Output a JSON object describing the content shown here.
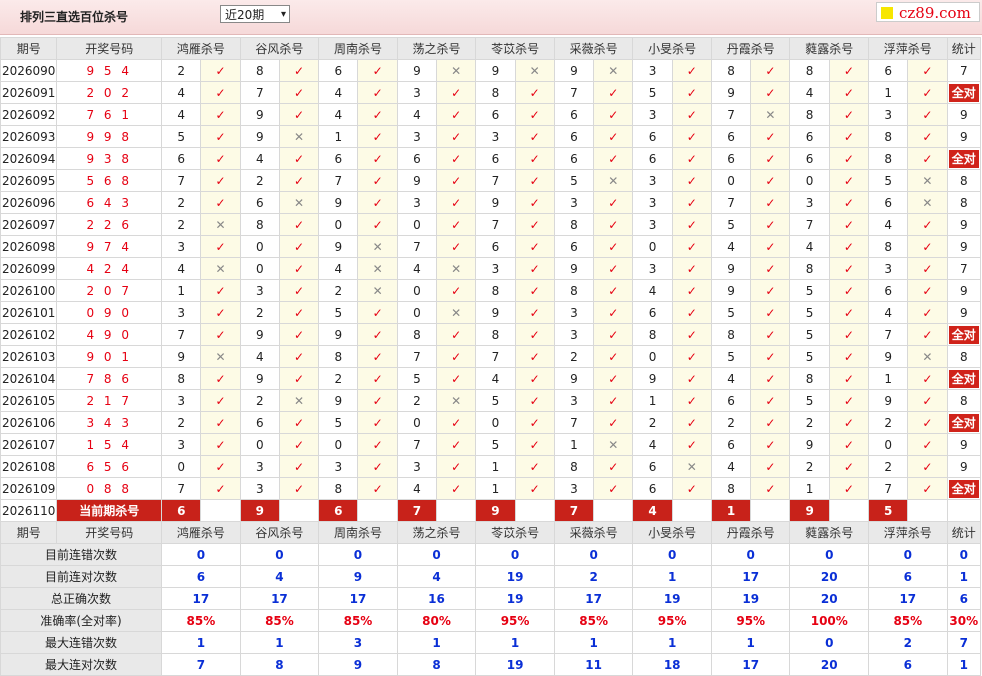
{
  "header": {
    "title": "排列三直选百位杀号",
    "select_value": "近20期",
    "logo_text": "cz89.com"
  },
  "columns": {
    "period": "期号",
    "number": "开奖号码",
    "experts": [
      "鸿雁杀号",
      "谷风杀号",
      "周南杀号",
      "荡之杀号",
      "苓苡杀号",
      "采薇杀号",
      "小旻杀号",
      "丹霞杀号",
      "蕤露杀号",
      "浮萍杀号"
    ],
    "stat": "统计"
  },
  "rows": [
    {
      "period": "2026090",
      "number": "954",
      "kills": [
        2,
        8,
        6,
        9,
        9,
        9,
        3,
        8,
        8,
        6
      ],
      "hits": [
        1,
        1,
        1,
        0,
        0,
        0,
        1,
        1,
        1,
        1
      ],
      "stat": "7"
    },
    {
      "period": "2026091",
      "number": "202",
      "kills": [
        4,
        7,
        4,
        3,
        8,
        7,
        5,
        9,
        4,
        1
      ],
      "hits": [
        1,
        1,
        1,
        1,
        1,
        1,
        1,
        1,
        1,
        1
      ],
      "stat": "全对"
    },
    {
      "period": "2026092",
      "number": "761",
      "kills": [
        4,
        9,
        4,
        4,
        6,
        6,
        3,
        7,
        8,
        3
      ],
      "hits": [
        1,
        1,
        1,
        1,
        1,
        1,
        1,
        0,
        1,
        1
      ],
      "stat": "9"
    },
    {
      "period": "2026093",
      "number": "998",
      "kills": [
        5,
        9,
        1,
        3,
        3,
        6,
        6,
        6,
        6,
        8
      ],
      "hits": [
        1,
        0,
        1,
        1,
        1,
        1,
        1,
        1,
        1,
        1
      ],
      "stat": "9"
    },
    {
      "period": "2026094",
      "number": "938",
      "kills": [
        6,
        4,
        6,
        6,
        6,
        6,
        6,
        6,
        6,
        8
      ],
      "hits": [
        1,
        1,
        1,
        1,
        1,
        1,
        1,
        1,
        1,
        1
      ],
      "stat": "全对"
    },
    {
      "period": "2026095",
      "number": "568",
      "kills": [
        7,
        2,
        7,
        9,
        7,
        5,
        3,
        0,
        0,
        5
      ],
      "hits": [
        1,
        1,
        1,
        1,
        1,
        0,
        1,
        1,
        1,
        0
      ],
      "stat": "8"
    },
    {
      "period": "2026096",
      "number": "643",
      "kills": [
        2,
        6,
        9,
        3,
        9,
        3,
        3,
        7,
        3,
        6
      ],
      "hits": [
        1,
        0,
        1,
        1,
        1,
        1,
        1,
        1,
        1,
        0
      ],
      "stat": "8"
    },
    {
      "period": "2026097",
      "number": "226",
      "kills": [
        2,
        8,
        0,
        0,
        7,
        8,
        3,
        5,
        7,
        4
      ],
      "hits": [
        0,
        1,
        1,
        1,
        1,
        1,
        1,
        1,
        1,
        1
      ],
      "stat": "9"
    },
    {
      "period": "2026098",
      "number": "974",
      "kills": [
        3,
        0,
        9,
        7,
        6,
        6,
        0,
        4,
        4,
        8
      ],
      "hits": [
        1,
        1,
        0,
        1,
        1,
        1,
        1,
        1,
        1,
        1
      ],
      "stat": "9"
    },
    {
      "period": "2026099",
      "number": "424",
      "kills": [
        4,
        0,
        4,
        4,
        3,
        9,
        3,
        9,
        8,
        3
      ],
      "hits": [
        0,
        1,
        0,
        0,
        1,
        1,
        1,
        1,
        1,
        1
      ],
      "stat": "7"
    },
    {
      "period": "2026100",
      "number": "207",
      "kills": [
        1,
        3,
        2,
        0,
        8,
        8,
        4,
        9,
        5,
        6
      ],
      "hits": [
        1,
        1,
        0,
        1,
        1,
        1,
        1,
        1,
        1,
        1
      ],
      "stat": "9"
    },
    {
      "period": "2026101",
      "number": "090",
      "kills": [
        3,
        2,
        5,
        0,
        9,
        3,
        6,
        5,
        5,
        4
      ],
      "hits": [
        1,
        1,
        1,
        0,
        1,
        1,
        1,
        1,
        1,
        1
      ],
      "stat": "9"
    },
    {
      "period": "2026102",
      "number": "490",
      "kills": [
        7,
        9,
        9,
        8,
        8,
        3,
        8,
        8,
        5,
        7
      ],
      "hits": [
        1,
        1,
        1,
        1,
        1,
        1,
        1,
        1,
        1,
        1
      ],
      "stat": "全对"
    },
    {
      "period": "2026103",
      "number": "901",
      "kills": [
        9,
        4,
        8,
        7,
        7,
        2,
        0,
        5,
        5,
        9
      ],
      "hits": [
        0,
        1,
        1,
        1,
        1,
        1,
        1,
        1,
        1,
        0
      ],
      "stat": "8"
    },
    {
      "period": "2026104",
      "number": "786",
      "kills": [
        8,
        9,
        2,
        5,
        4,
        9,
        9,
        4,
        8,
        1
      ],
      "hits": [
        1,
        1,
        1,
        1,
        1,
        1,
        1,
        1,
        1,
        1
      ],
      "stat": "全对"
    },
    {
      "period": "2026105",
      "number": "217",
      "kills": [
        3,
        2,
        9,
        2,
        5,
        3,
        1,
        6,
        5,
        9
      ],
      "hits": [
        1,
        0,
        1,
        0,
        1,
        1,
        1,
        1,
        1,
        1
      ],
      "stat": "8"
    },
    {
      "period": "2026106",
      "number": "343",
      "kills": [
        2,
        6,
        5,
        0,
        0,
        7,
        2,
        2,
        2,
        2
      ],
      "hits": [
        1,
        1,
        1,
        1,
        1,
        1,
        1,
        1,
        1,
        1
      ],
      "stat": "全对"
    },
    {
      "period": "2026107",
      "number": "154",
      "kills": [
        3,
        0,
        0,
        7,
        5,
        1,
        4,
        6,
        9,
        0
      ],
      "hits": [
        1,
        1,
        1,
        1,
        1,
        0,
        1,
        1,
        1,
        1
      ],
      "stat": "9"
    },
    {
      "period": "2026108",
      "number": "656",
      "kills": [
        0,
        3,
        3,
        3,
        1,
        8,
        6,
        4,
        2,
        2
      ],
      "hits": [
        1,
        1,
        1,
        1,
        1,
        1,
        0,
        1,
        1,
        1
      ],
      "stat": "9"
    },
    {
      "period": "2026109",
      "number": "088",
      "kills": [
        7,
        3,
        8,
        4,
        1,
        3,
        6,
        8,
        1,
        7
      ],
      "hits": [
        1,
        1,
        1,
        1,
        1,
        1,
        1,
        1,
        1,
        1
      ],
      "stat": "全对"
    }
  ],
  "current": {
    "period": "2026110",
    "label": "当前期杀号",
    "kills": [
      "6",
      "9",
      "6",
      "7",
      "9",
      "7",
      "4",
      "1",
      "9",
      "5"
    ]
  },
  "summary": [
    {
      "label": "目前连错次数",
      "values": [
        "0",
        "0",
        "0",
        "0",
        "0",
        "0",
        "0",
        "0",
        "0",
        "0"
      ],
      "stat": "0",
      "cls": "blue"
    },
    {
      "label": "目前连对次数",
      "values": [
        "6",
        "4",
        "9",
        "4",
        "19",
        "2",
        "1",
        "17",
        "20",
        "6"
      ],
      "stat": "1",
      "cls": "blue"
    },
    {
      "label": "总正确次数",
      "values": [
        "17",
        "17",
        "17",
        "16",
        "19",
        "17",
        "19",
        "19",
        "20",
        "17"
      ],
      "stat": "6",
      "cls": "blue"
    },
    {
      "label": "准确率(全对率)",
      "values": [
        "85%",
        "85%",
        "85%",
        "80%",
        "95%",
        "85%",
        "95%",
        "95%",
        "100%",
        "85%"
      ],
      "stat": "30%",
      "cls": "red"
    },
    {
      "label": "最大连错次数",
      "values": [
        "1",
        "1",
        "3",
        "1",
        "1",
        "1",
        "1",
        "1",
        "0",
        "2"
      ],
      "stat": "7",
      "cls": "blue"
    },
    {
      "label": "最大连对次数",
      "values": [
        "7",
        "8",
        "9",
        "8",
        "19",
        "11",
        "18",
        "17",
        "20",
        "6"
      ],
      "stat": "1",
      "cls": "blue"
    }
  ],
  "marks": {
    "hit": "✓",
    "miss": "✕"
  },
  "colors": {
    "accent": "#e60012",
    "badge": "#d0231a",
    "blue": "#0a2fd6",
    "header_bg": "#e9e9e9",
    "cell_bg": "#fdfbe6"
  }
}
